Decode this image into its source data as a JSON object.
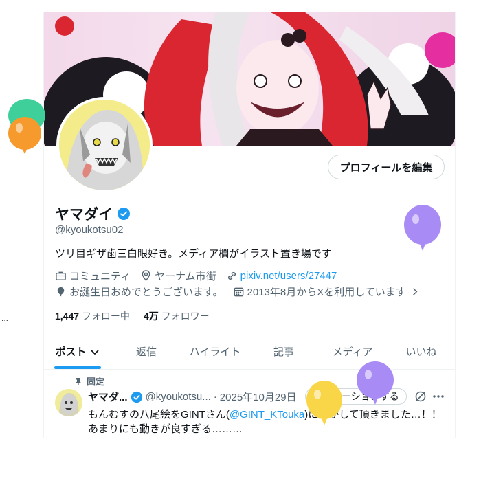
{
  "profile": {
    "display_name": "ヤマダイ",
    "handle": "@kyoukotsu02",
    "bio": "ツリ目ギザ歯三白眼好き。メディア欄がイラスト置き場です",
    "edit_profile_label": "プロフィールを編集",
    "meta": {
      "community": "コミュニティ",
      "location": "ヤーナム市街",
      "link_text": "pixiv.net/users/27447",
      "birthday": "お誕生日おめでとうございます。",
      "joined": "2013年8月からXを利用しています"
    },
    "following_count": "1,447",
    "following_label": "フォロー中",
    "followers_count": "4万",
    "followers_label": "フォロワー"
  },
  "tabs": [
    {
      "label": "ポスト",
      "active": true
    },
    {
      "label": "返信",
      "active": false
    },
    {
      "label": "ハイライト",
      "active": false
    },
    {
      "label": "記事",
      "active": false
    },
    {
      "label": "メディア",
      "active": false
    },
    {
      "label": "いいね",
      "active": false
    }
  ],
  "pinned_tweet": {
    "pinned_label": "固定",
    "name": "ヤマダ...",
    "handle": "@kyoukotsu...",
    "separator": "·",
    "date": "2025年10月29日",
    "promote_label": "プロモーションする",
    "text_before": "もんむすの八尾絵をGINTさん(",
    "mention": "@GINT_KTouka",
    "text_after": ")に動かして頂きました…！！",
    "text_line2": "あまりにも動きが良すぎる………"
  },
  "colors": {
    "accent": "#1d9bf0",
    "text": "#0f1419",
    "secondary": "#536471",
    "balloon_teal": "#3ecf9a",
    "balloon_orange": "#f79a2e",
    "balloon_purple": "#a98bf5",
    "balloon_yellow": "#f9d548"
  },
  "icons": {
    "verified": "verified-badge-icon",
    "community": "briefcase-icon",
    "location": "location-pin-icon",
    "link": "link-icon",
    "birthday": "balloon-icon",
    "joined": "calendar-icon",
    "chevron": "chevron-right-icon",
    "tab_dropdown": "chevron-down-icon",
    "pin": "pin-icon",
    "grok": "grok-icon",
    "more": "more-dots-icon"
  },
  "misc": {
    "left_ellipsis": "..."
  }
}
